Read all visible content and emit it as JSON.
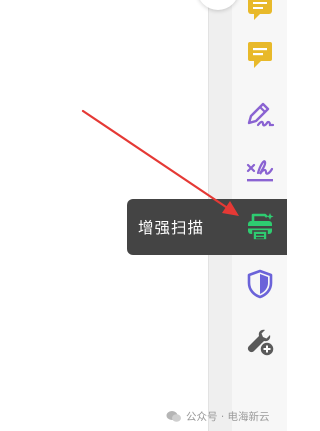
{
  "tooltip": {
    "text": "增强扫描"
  },
  "toolbar": {
    "tools": [
      {
        "name": "comment",
        "icon": "comment-icon",
        "color": "#e8b92a"
      },
      {
        "name": "note",
        "icon": "note-icon",
        "color": "#e8b92a"
      },
      {
        "name": "draw",
        "icon": "pen-draw-icon",
        "color": "#8a63d2"
      },
      {
        "name": "signature",
        "icon": "signature-icon",
        "color": "#8a63d2"
      },
      {
        "name": "enhanced-scan",
        "icon": "scanner-icon",
        "color": "#2ecc71"
      },
      {
        "name": "protect",
        "icon": "shield-icon",
        "color": "#6b63d9"
      },
      {
        "name": "more-tools",
        "icon": "wrench-plus-icon",
        "color": "#5a5a5a"
      }
    ]
  },
  "annotation": {
    "arrow_color": "#e53935"
  },
  "watermark": {
    "text": "公众号 · 电海新云"
  }
}
